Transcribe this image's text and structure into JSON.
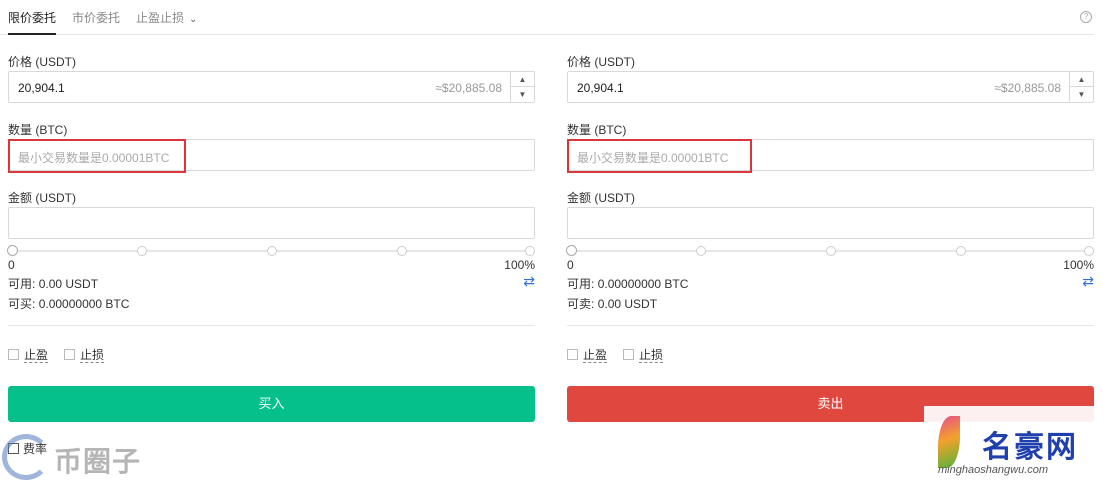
{
  "tabs": [
    {
      "label": "限价委托",
      "active": true
    },
    {
      "label": "市价委托",
      "active": false
    },
    {
      "label": "止盈止损",
      "active": false
    }
  ],
  "buy": {
    "price_label": "价格 (USDT)",
    "price_value": "20,904.1",
    "price_approx": "≈$20,885.08",
    "amount_label": "数量 (BTC)",
    "amount_placeholder": "最小交易数量是0.00001BTC",
    "total_label": "金额 (USDT)",
    "slider_min": "0",
    "slider_max": "100%",
    "slider_value": 0,
    "available_label": "可用:",
    "available_value": "0.00 USDT",
    "can_label": "可买:",
    "can_value": "0.00000000 BTC",
    "take_profit": "止盈",
    "stop_loss": "止损",
    "action_label": "买入",
    "action_color": "#05c08b"
  },
  "sell": {
    "price_label": "价格 (USDT)",
    "price_value": "20,904.1",
    "price_approx": "≈$20,885.08",
    "amount_label": "数量 (BTC)",
    "amount_placeholder": "最小交易数量是0.00001BTC",
    "total_label": "金额 (USDT)",
    "slider_min": "0",
    "slider_max": "100%",
    "slider_value": 0,
    "available_label": "可用:",
    "available_value": "0.00000000 BTC",
    "can_label": "可卖:",
    "can_value": "0.00 USDT",
    "take_profit": "止盈",
    "stop_loss": "止损",
    "action_label": "卖出",
    "action_color": "#e0473e"
  },
  "fee_label": "费率",
  "watermarks": {
    "left_text": "币圈子",
    "right_text": "名豪网",
    "right_url": "minghaoshangwu.com"
  },
  "icons": {
    "help": "question-circle-icon",
    "swap": "swap-arrows-icon",
    "stepper_up": "caret-up-icon",
    "stepper_down": "caret-down-icon",
    "chevron": "chevron-down-icon"
  }
}
